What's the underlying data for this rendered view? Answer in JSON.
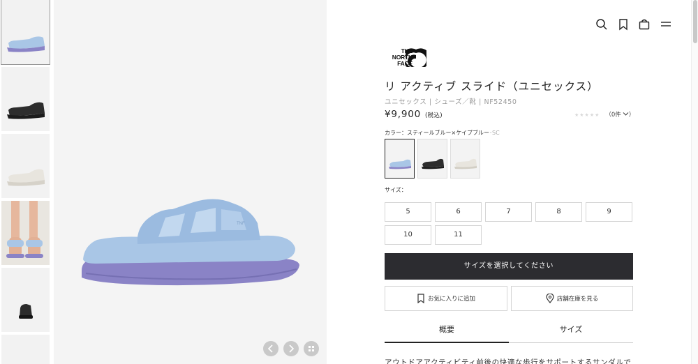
{
  "header": {
    "icons": [
      "search-icon",
      "bookmark-icon",
      "cart-icon",
      "menu-icon"
    ]
  },
  "brand": {
    "logo_lines": [
      "THE",
      "NORTH",
      "FACE"
    ]
  },
  "product": {
    "title": "リ アクティブ スライド（ユニセックス）",
    "subtitle": "ユニセックス | シューズ／靴 | NF52450",
    "price": "¥9,900",
    "tax_label": "(税込)",
    "rating_count": "（0件",
    "rating_chevron": "chevron-down-icon",
    "color_label": "カラー：スティールブルー×ケイプブルー",
    "color_code": "･SC",
    "colors": [
      {
        "name": "steel-blue",
        "upper": "#a9c6e6",
        "sole": "#8a83c6"
      },
      {
        "name": "black",
        "upper": "#2a2a2a",
        "sole": "#1a1a1a"
      },
      {
        "name": "white",
        "upper": "#e9e6df",
        "sole": "#d9d5cc"
      }
    ],
    "size_label": "サイズ：",
    "sizes": [
      "5",
      "6",
      "7",
      "8",
      "9",
      "10",
      "11"
    ],
    "select_size_label": "サイズを選択してください",
    "favorite_label": "お気に入りに追加",
    "store_stock_label": "店舗在庫を見る",
    "tabs": [
      "概要",
      "サイズ"
    ],
    "description": "アウトドアアクティビティ前後の快適な歩行をサポートするサンダルで"
  },
  "gallery": {
    "prev_icon": "chevron-left-icon",
    "next_icon": "chevron-right-icon",
    "grid_icon": "grid-icon",
    "accent_upper": "#a9c6e6",
    "accent_sole": "#8a83c6"
  }
}
